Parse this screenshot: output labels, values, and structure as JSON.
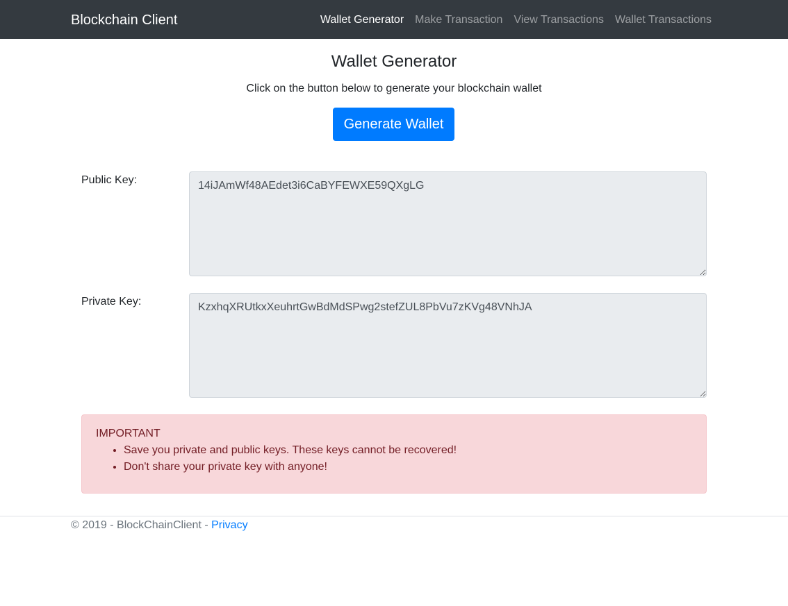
{
  "navbar": {
    "brand": "Blockchain Client",
    "links": [
      {
        "label": "Wallet Generator",
        "active": true
      },
      {
        "label": "Make Transaction",
        "active": false
      },
      {
        "label": "View Transactions",
        "active": false
      },
      {
        "label": "Wallet Transactions",
        "active": false
      }
    ]
  },
  "main": {
    "title": "Wallet Generator",
    "intro": "Click on the button below to generate your blockchain wallet",
    "generate_button": "Generate Wallet",
    "public_key": {
      "label": "Public Key:",
      "value": "14iJAmWf48AEdet3i6CaBYFEWXE59QXgLG"
    },
    "private_key": {
      "label": "Private Key:",
      "value": "KzxhqXRUtkxXeuhrtGwBdMdSPwg2stefZUL8PbVu7zKVg48VNhJA"
    }
  },
  "alert": {
    "heading": "IMPORTANT",
    "items": [
      "Save you private and public keys. These keys cannot be recovered!",
      "Don't share your private key with anyone!"
    ]
  },
  "footer": {
    "copyright": "© 2019 - BlockChainClient - ",
    "privacy_link": "Privacy"
  },
  "colors": {
    "navbar_bg": "#343a40",
    "primary": "#007bff",
    "alert_bg": "#f8d7da",
    "alert_text": "#721c24",
    "readonly_field_bg": "#e9ecef"
  }
}
